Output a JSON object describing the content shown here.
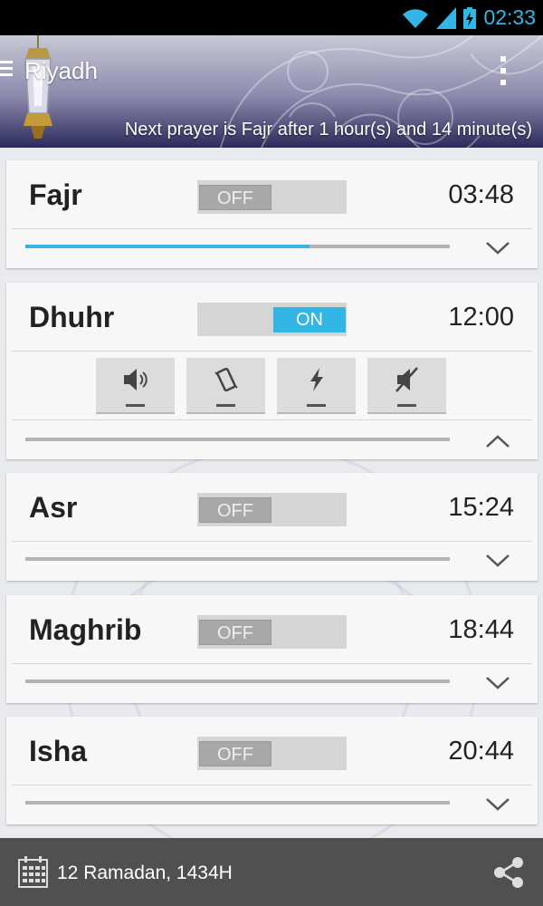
{
  "status_bar": {
    "time": "02:33"
  },
  "header": {
    "city": "Riyadh",
    "next_prayer": "Next prayer is Fajr after 1 hour(s) and 14 minute(s)"
  },
  "prayers": [
    {
      "name": "Fajr",
      "toggle": "OFF",
      "time": "03:48",
      "progress": 0.67,
      "expanded": false
    },
    {
      "name": "Dhuhr",
      "toggle": "ON",
      "time": "12:00",
      "progress": 0,
      "expanded": true,
      "options": [
        "sound-icon",
        "vibrate-icon",
        "flash-icon",
        "mute-icon"
      ]
    },
    {
      "name": "Asr",
      "toggle": "OFF",
      "time": "15:24",
      "progress": 0,
      "expanded": false
    },
    {
      "name": "Maghrib",
      "toggle": "OFF",
      "time": "18:44",
      "progress": 0,
      "expanded": false
    },
    {
      "name": "Isha",
      "toggle": "OFF",
      "time": "20:44",
      "progress": 0,
      "expanded": false
    }
  ],
  "footer": {
    "date": "12 Ramadan, 1434H"
  },
  "colors": {
    "accent": "#33b5e5",
    "footer": "#505050",
    "card": "#f7f7f7"
  }
}
